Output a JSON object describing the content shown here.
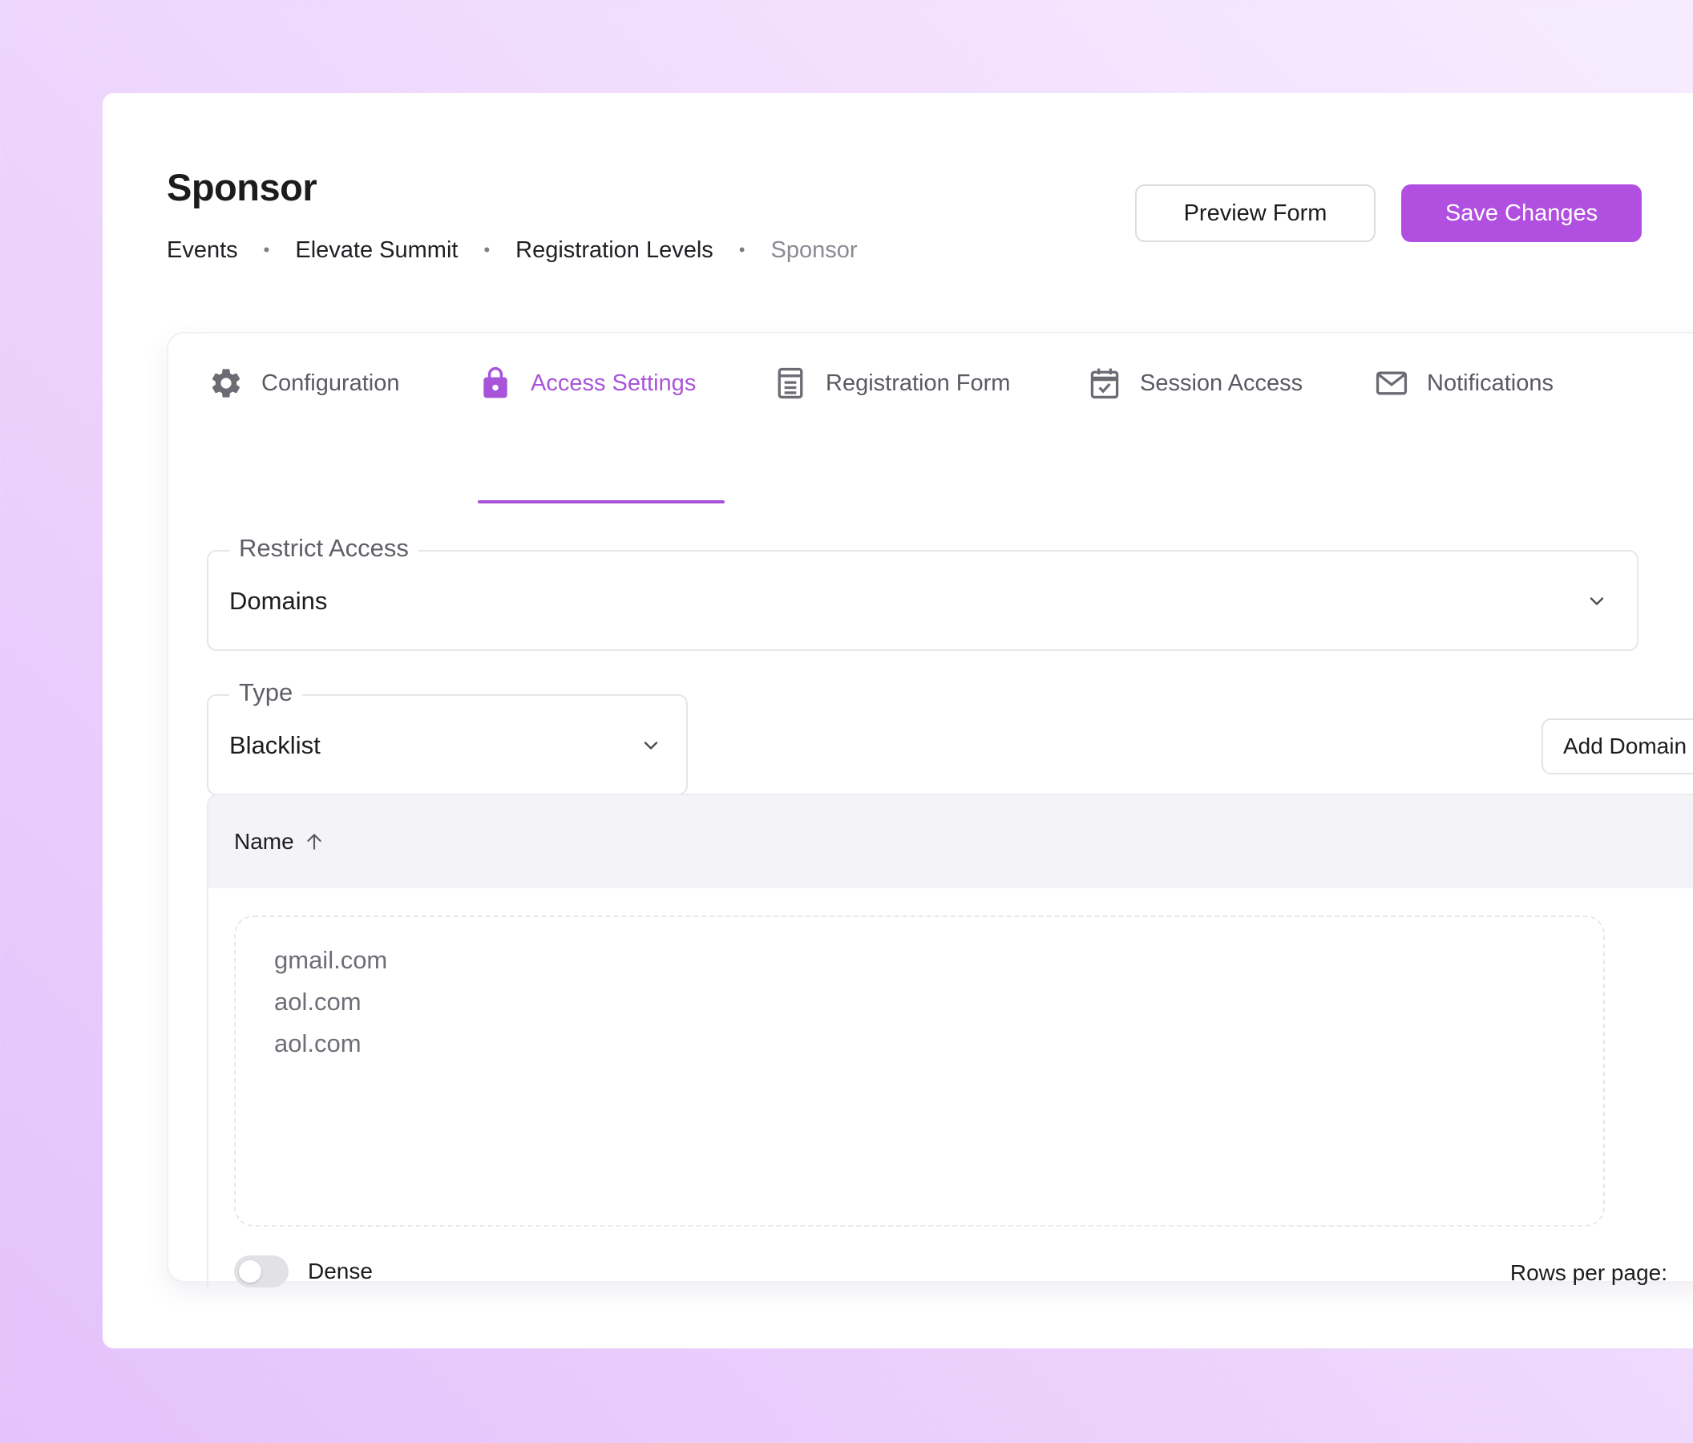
{
  "header": {
    "title": "Sponsor",
    "breadcrumb": [
      "Events",
      "Elevate Summit",
      "Registration Levels",
      "Sponsor"
    ],
    "breadcrumb_separator": "•",
    "preview_label": "Preview Form",
    "save_label": "Save Changes"
  },
  "tabs": [
    {
      "label": "Configuration",
      "icon": "gear-icon"
    },
    {
      "label": "Access Settings",
      "icon": "lock-icon",
      "active": true
    },
    {
      "label": "Registration Form",
      "icon": "form-icon"
    },
    {
      "label": "Session Access",
      "icon": "calendar-check-icon"
    },
    {
      "label": "Notifications",
      "icon": "mail-icon"
    }
  ],
  "restrict_access": {
    "label": "Restrict Access",
    "value": "Domains"
  },
  "type_field": {
    "label": "Type",
    "value": "Blacklist"
  },
  "add_domain_label": "Add Domain",
  "table": {
    "column": "Name",
    "sort": "ascending",
    "domains": [
      "gmail.com",
      "aol.com",
      "aol.com"
    ]
  },
  "footer": {
    "dense_label": "Dense",
    "dense_enabled": false,
    "rows_per_page_label": "Rows per page:"
  },
  "colors": {
    "accent": "#a754d9",
    "primary_button": "#b150e0",
    "background_gradient": [
      "#e5c2fb",
      "#f7ecff"
    ]
  }
}
